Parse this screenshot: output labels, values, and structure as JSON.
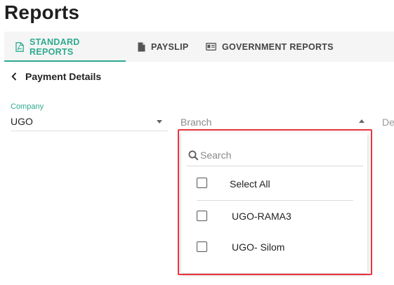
{
  "page": {
    "title": "Reports"
  },
  "tabs": [
    {
      "label": "STANDARD REPORTS",
      "icon": "pdf-file-icon",
      "active": true
    },
    {
      "label": "PAYSLIP",
      "icon": "document-icon",
      "active": false
    },
    {
      "label": "GOVERNMENT REPORTS",
      "icon": "id-card-icon",
      "active": false
    }
  ],
  "section": {
    "back_label": "Payment Details"
  },
  "filters": {
    "company": {
      "label": "Company",
      "value": "UGO"
    },
    "branch": {
      "placeholder": "Branch"
    },
    "third": {
      "partial_text": "De"
    }
  },
  "dropdown": {
    "search_placeholder": "Search",
    "select_all_label": "Select All",
    "options": [
      {
        "label": "UGO-RAMA3",
        "checked": false
      },
      {
        "label": "UGO- Silom",
        "checked": false
      }
    ]
  },
  "colors": {
    "accent": "#2eaa8e",
    "highlight": "#e8343c"
  }
}
